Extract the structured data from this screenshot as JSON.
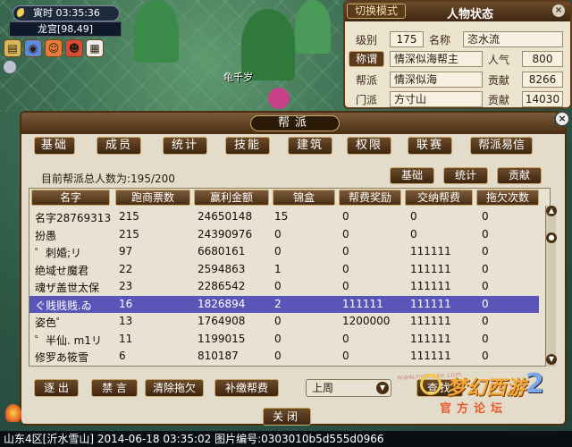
{
  "hud": {
    "time": "寅时  03:35:36",
    "place": "龙宫[98,49]",
    "npc_name": "龟千岁",
    "icons": [
      "box-icon",
      "globe-icon",
      "friend-icon",
      "team-icon",
      "calendar-icon"
    ]
  },
  "status_panel": {
    "switch_label": "切换模式",
    "title": "人物状态",
    "close_label": "×",
    "level_label": "级别",
    "level_value": "175",
    "name_label": "名称",
    "name_value": "恣水流",
    "title_label": "称谓",
    "title_value": "情深似海帮主",
    "popularity_label": "人气",
    "popularity_value": "800",
    "guild_label": "帮派",
    "guild_value": "情深似海",
    "contrib1_label": "贡献",
    "contrib1_value": "8266",
    "sect_label": "门派",
    "sect_value": "方寸山",
    "contrib2_label": "贡献",
    "contrib2_value": "14030"
  },
  "guild_panel": {
    "title": "帮派",
    "close_label": "×",
    "tabs": [
      "基础",
      "成员",
      "统计",
      "技能",
      "建筑",
      "权限",
      "联赛",
      "帮派易信"
    ],
    "total_label": "目前帮派总人数为:195/200",
    "sub_buttons": [
      "基础",
      "统计",
      "贡献"
    ],
    "columns": [
      "名字",
      "跑商票数",
      "赢利金额",
      "锦盒",
      "帮费奖励",
      "交纳帮费",
      "拖欠次数"
    ],
    "rows": [
      {
        "name": "名字28769313",
        "trades": "215",
        "profit": "24650148",
        "box": "15",
        "reward": "0",
        "paid": "0",
        "owed": "0"
      },
      {
        "name": "扮愚",
        "trades": "215",
        "profit": "24390976",
        "box": "0",
        "reward": "0",
        "paid": "0",
        "owed": "0"
      },
      {
        "name": "゜刺婚;リ",
        "trades": "97",
        "profit": "6680161",
        "box": "0",
        "reward": "0",
        "paid": "111111",
        "owed": "0"
      },
      {
        "name": "绝域せ魔君",
        "trades": "22",
        "profit": "2594863",
        "box": "1",
        "reward": "0",
        "paid": "111111",
        "owed": "0"
      },
      {
        "name": "魂ザ盖世太保",
        "trades": "23",
        "profit": "2286542",
        "box": "0",
        "reward": "0",
        "paid": "111111",
        "owed": "0"
      },
      {
        "name": "ぐ贱贱贱.ゐ",
        "trades": "16",
        "profit": "1826894",
        "box": "2",
        "reward": "111111",
        "paid": "111111",
        "owed": "0"
      },
      {
        "name": "姿色゜",
        "trades": "13",
        "profit": "1764908",
        "box": "0",
        "reward": "1200000",
        "paid": "111111",
        "owed": "0"
      },
      {
        "name": "゜半仙. m1リ",
        "trades": "11",
        "profit": "1199015",
        "box": "0",
        "reward": "0",
        "paid": "111111",
        "owed": "0"
      },
      {
        "name": "修罗あ筱雪",
        "trades": "6",
        "profit": "810187",
        "box": "0",
        "reward": "0",
        "paid": "111111",
        "owed": "0"
      }
    ],
    "selected_row": 5,
    "bottom_buttons": [
      "逐 出",
      "禁 言",
      "清除拖欠",
      "补缴帮费"
    ],
    "period_select": "上周",
    "search_label": "查找",
    "close_button": "关闭"
  },
  "watermark": "www.netease.com",
  "logo": {
    "text": "梦幻西游",
    "sub": "官方论坛",
    "number": "2"
  },
  "footer": "山东4区[沂水雪山] 2014-06-18 03:35:02 图片编号:0303010b5d555d0966",
  "colors": {
    "selected_row": "#5a55b8",
    "panel_bg": "#e3dcca",
    "button_brown": "#4a2e12"
  }
}
